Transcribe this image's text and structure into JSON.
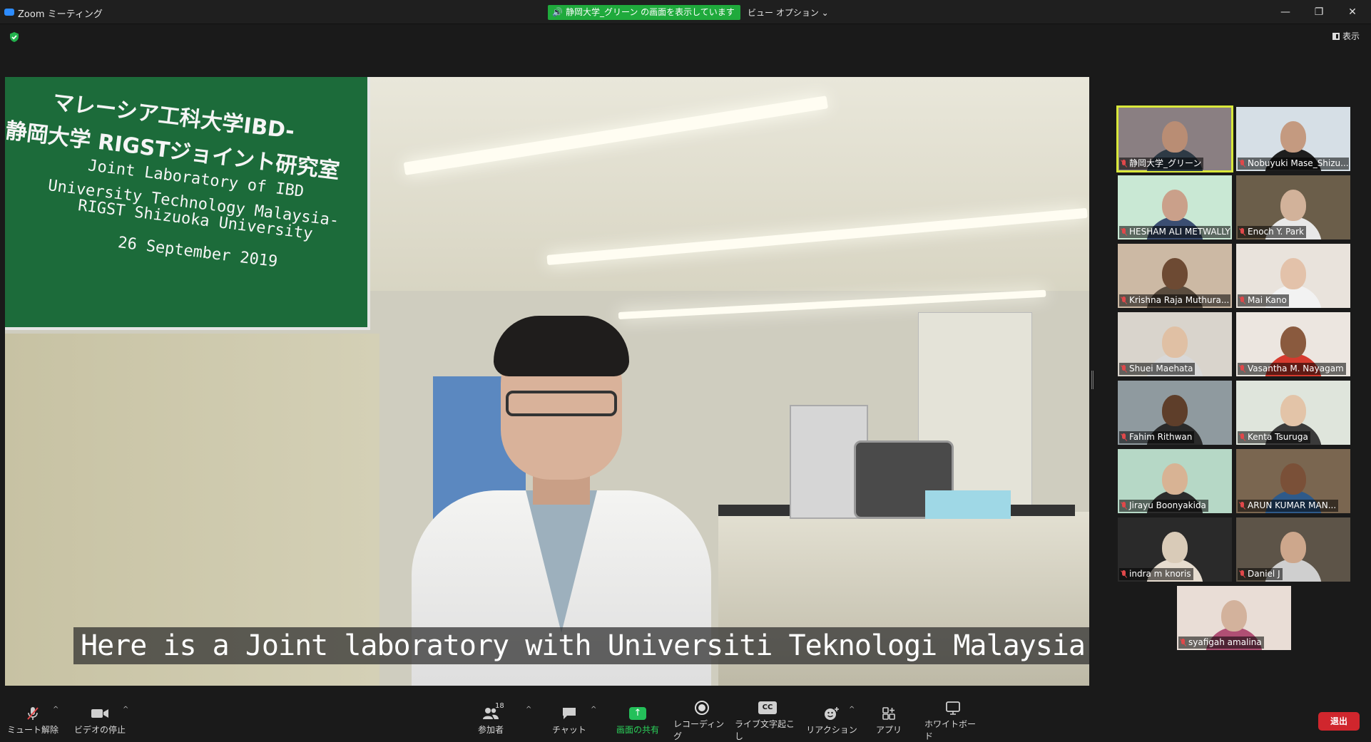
{
  "titlebar": {
    "app_title": "Zoom ミーティング",
    "share_notice": "静岡大学_グリーン の画面を表示しています",
    "view_options": "ビュー オプション ⌄",
    "minimize": "—",
    "restore": "❐",
    "close": "✕"
  },
  "top": {
    "view_toggle": "表示"
  },
  "shared_screen": {
    "sign": {
      "line1": "マレーシア工科大学IBD-",
      "line2": "静岡大学 RIGSTジョイント研究室",
      "line3": "Joint Laboratory of IBD",
      "line4": "University Technology Malaysia-",
      "line5": "RIGST Shizuoka University",
      "line6": "26 September 2019"
    },
    "caption": "Here is a Joint laboratory with Universiti Teknologi Malaysia."
  },
  "participants": [
    {
      "name": "静岡大学_グリーン",
      "active": true,
      "bg": "#8a7f82",
      "skin": "#b98d74",
      "shirt": "#2e3a45"
    },
    {
      "name": "Nobuyuki Mase_Shizu...",
      "active": false,
      "bg": "#d6dfe6",
      "skin": "#c49a80",
      "shirt": "#1e1e1e"
    },
    {
      "name": "HESHAM ALI METWALLY ...",
      "active": false,
      "bg": "#c9e8d4",
      "skin": "#caa08a",
      "shirt": "#3b4e72"
    },
    {
      "name": "Enoch Y. Park",
      "active": false,
      "bg": "#6b5e4a",
      "skin": "#d2b29a",
      "shirt": "#e8e8e8"
    },
    {
      "name": "Krishna Raja Muthura...",
      "active": false,
      "bg": "#ccb9a4",
      "skin": "#6d4a33",
      "shirt": "#5a4c3e"
    },
    {
      "name": "Mai Kano",
      "active": false,
      "bg": "#e9e3dc",
      "skin": "#e3c2aa",
      "shirt": "#f2f2f2"
    },
    {
      "name": "Shuei Maehata",
      "active": false,
      "bg": "#d9d4cc",
      "skin": "#e0c0a4",
      "shirt": "#d8d8d8"
    },
    {
      "name": "Vasantha M. Nayagam",
      "active": false,
      "bg": "#ece6e0",
      "skin": "#8a5a3e",
      "shirt": "#d63a2e"
    },
    {
      "name": "Fahim Rithwan",
      "active": false,
      "bg": "#8f9a9f",
      "skin": "#5e3e2a",
      "shirt": "#2a2a2a"
    },
    {
      "name": "Kenta Tsuruga",
      "active": false,
      "bg": "#dfe5dc",
      "skin": "#e3c4a8",
      "shirt": "#3a3a3a"
    },
    {
      "name": "Jirayu Boonyakida",
      "active": false,
      "bg": "#b6d8c6",
      "skin": "#d8b394",
      "shirt": "#2c2c2c"
    },
    {
      "name": "ARUN KUMAR MAN...",
      "active": false,
      "bg": "#7a6650",
      "skin": "#7a5038",
      "shirt": "#2e5a8a"
    },
    {
      "name": "indra m knoris",
      "active": false,
      "bg": "#2a2a2a",
      "skin": "#d9cbb8",
      "shirt": "#e6dccf"
    },
    {
      "name": "Daniel J",
      "active": false,
      "bg": "#5d5448",
      "skin": "#cda78c",
      "shirt": "#cfcfcf"
    },
    {
      "name": "syafigah amalina",
      "active": false,
      "bg": "#e9ddd6",
      "skin": "#d3b29c",
      "shirt": "#b04f74"
    }
  ],
  "toolbar": {
    "mute": "ミュート解除",
    "video": "ビデオの停止",
    "participants": "参加者",
    "participant_count": "18",
    "chat": "チャット",
    "share": "画面の共有",
    "record": "レコーディング",
    "captions": "ライブ文字起こし",
    "captions_icon": "CC",
    "reactions": "リアクション",
    "apps": "アプリ",
    "whiteboard": "ホワイトボード",
    "leave": "退出"
  }
}
